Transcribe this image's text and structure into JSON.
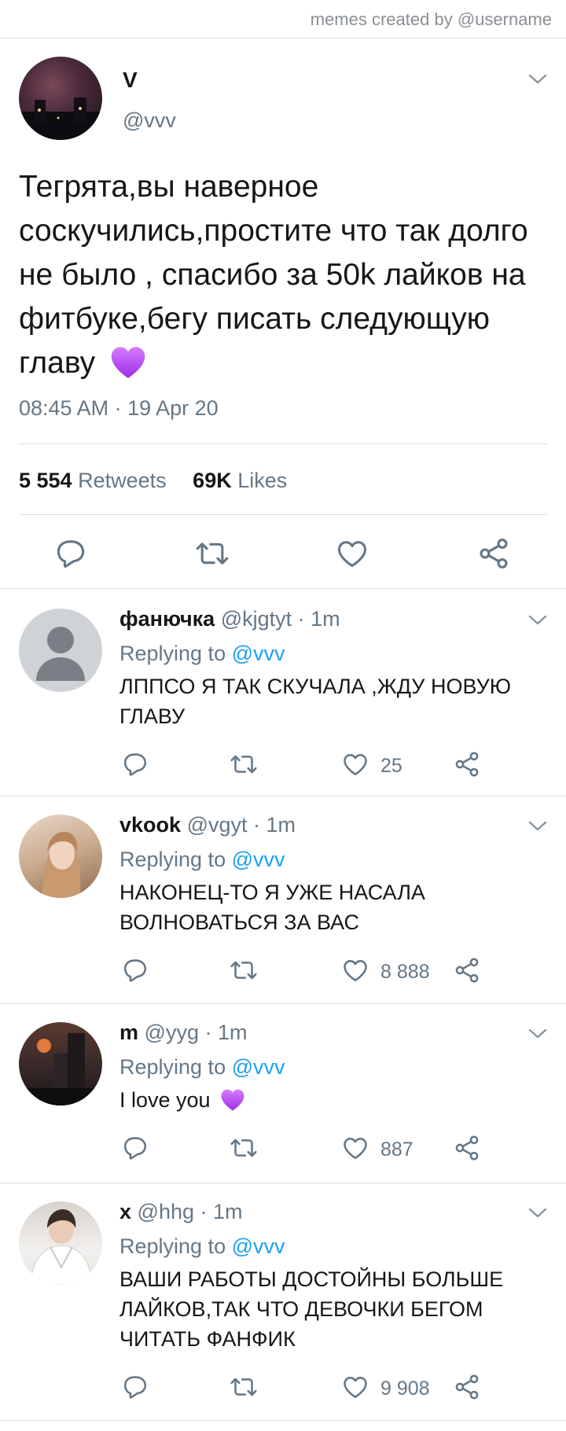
{
  "watermark": "memes created by @username",
  "tweet": {
    "name": "V",
    "handle": "@vvv",
    "text": "Тегрята,вы наверное соскучились,простите что так долго не было , спасибо за 50k лайков на фитбуке,бегу писать следующую главу",
    "emoji": "purple-heart",
    "timestamp": "08:45 AM · 19 Apr 20",
    "retweets_count": "5 554",
    "retweets_label": "Retweets",
    "likes_count": "69K",
    "likes_label": "Likes"
  },
  "replies": [
    {
      "name": "фанючка",
      "handle_time": "@kjgtyt · 1m",
      "replying_prefix": "Replying to",
      "replying_mention": "@vvv",
      "text": "ЛППСО Я ТАК СКУЧАЛА ,ЖДУ НОВУЮ ГЛАВУ",
      "likes": "25"
    },
    {
      "name": "vkook",
      "handle_time": "@vgyt · 1m",
      "replying_prefix": "Replying to",
      "replying_mention": "@vvv",
      "text": "НАКОНЕЦ-ТО Я УЖЕ НАСАЛА ВОЛНОВАТЬСЯ ЗА ВАС",
      "likes": "8 888"
    },
    {
      "name": "m",
      "handle_time": "@yyg · 1m",
      "replying_prefix": "Replying to",
      "replying_mention": "@vvv",
      "text": "I love you",
      "emoji": "purple-heart",
      "likes": "887"
    },
    {
      "name": "x",
      "handle_time": "@hhg · 1m",
      "replying_prefix": "Replying to",
      "replying_mention": "@vvv",
      "text": "ВАШИ РАБОТЫ ДОСТОЙНЫ БОЛЬШЕ ЛАЙКОВ,ТАК ЧТО ДЕВОЧКИ БЕГОМ ЧИТАТЬ ФАНФИК",
      "likes": "9 908"
    }
  ],
  "colors": {
    "text": "#14171a",
    "secondary": "#657786",
    "link": "#1da1f2",
    "divider": "#d9dde0",
    "emoji": "#b04bf0"
  }
}
